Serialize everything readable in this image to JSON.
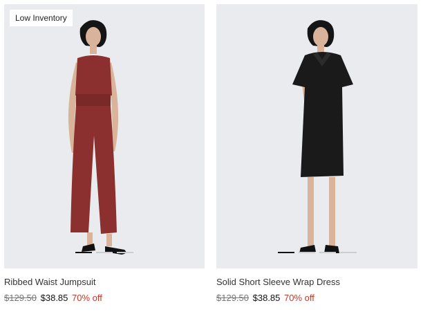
{
  "products": [
    {
      "badge": "Low Inventory",
      "name": "Ribbed Waist Jumpsuit",
      "original_price": "$129.50",
      "sale_price": "$38.85",
      "discount": "70% off",
      "image_dots": 3,
      "active_dot": 0
    },
    {
      "badge": "",
      "name": "Solid Short Sleeve Wrap Dress",
      "original_price": "$129.50",
      "sale_price": "$38.85",
      "discount": "70% off",
      "image_dots": 4,
      "active_dot": 0
    }
  ],
  "colors": {
    "image_bg": "#e9ebee",
    "discount": "#c0392b",
    "jumpsuit": "#8b2f2f",
    "dress": "#1a1a1a"
  }
}
